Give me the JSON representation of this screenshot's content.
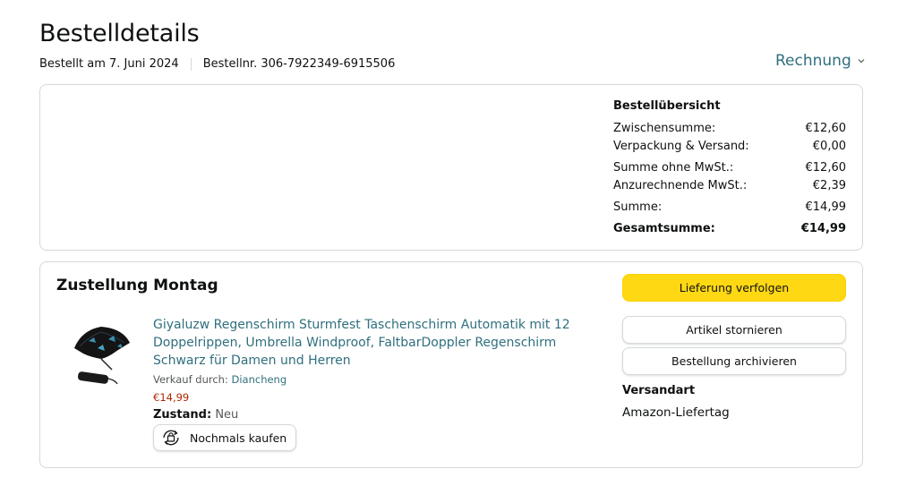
{
  "header": {
    "title": "Bestelldetails",
    "order_date": "Bestellt am 7. Juni 2024",
    "order_number": "Bestellnr. 306-7922349-6915506",
    "invoice_label": "Rechnung"
  },
  "summary": {
    "heading": "Bestellübersicht",
    "rows": [
      {
        "label": "Zwischensumme:",
        "value": "€12,60"
      },
      {
        "label": "Verpackung & Versand:",
        "value": "€0,00"
      },
      {
        "label": "Summe ohne MwSt.:",
        "value": "€12,60"
      },
      {
        "label": "Anzurechnende MwSt.:",
        "value": "€2,39"
      },
      {
        "label": "Summe:",
        "value": "€14,99"
      }
    ],
    "total_label": "Gesamtsumme:",
    "total_value": "€14,99"
  },
  "shipment": {
    "title": "Zustellung Montag",
    "product_title": "Giyaluzw Regenschirm Sturmfest Taschenschirm Automatik mit 12 Doppelrippen, Umbrella Windproof, FaltbarDoppler Regenschirm Schwarz für Damen und Herren",
    "seller_label": "Verkauf durch:",
    "seller_name": "Diancheng",
    "price": "€14,99",
    "condition_label": "Zustand:",
    "condition_value": "Neu",
    "buy_again_label": "Nochmals kaufen",
    "track_label": "Lieferung verfolgen",
    "cancel_label": "Artikel stornieren",
    "archive_label": "Bestellung archivieren",
    "ship_method_label": "Versandart",
    "ship_method_value": "Amazon-Liefertag"
  },
  "colors": {
    "link": "#2f6f7e",
    "price": "#b12704",
    "primary_button": "#ffd814"
  },
  "icons": {
    "invoice_chevron": "chevron-down-icon",
    "buy_again": "buy-again-icon",
    "product_image": "umbrella-product-image"
  }
}
